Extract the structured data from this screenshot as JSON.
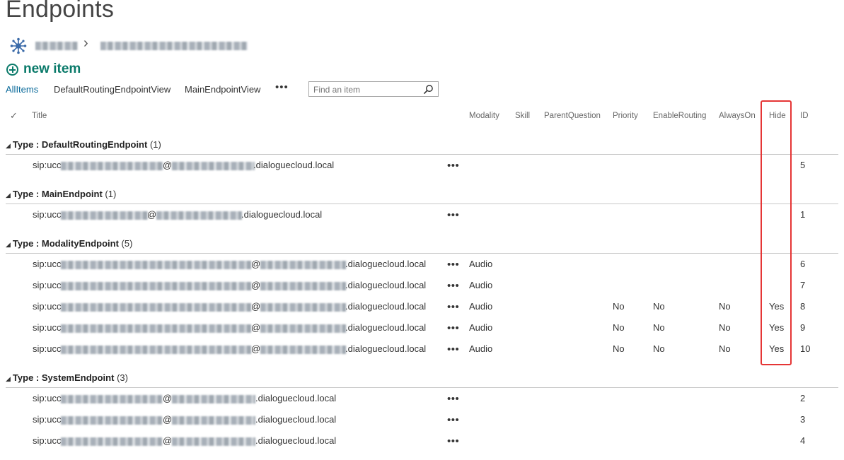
{
  "page": {
    "title": "Endpoints"
  },
  "new_item": {
    "label": "new item"
  },
  "views": [
    "AllItems",
    "DefaultRoutingEndpointView",
    "MainEndpointView"
  ],
  "more_views": "•••",
  "search": {
    "placeholder": "Find an item"
  },
  "columns": {
    "check": "✓",
    "title": "Title",
    "modality": "Modality",
    "skill": "Skill",
    "parent_question": "ParentQuestion",
    "priority": "Priority",
    "enable_routing": "EnableRouting",
    "always_on": "AlwaysOn",
    "hide": "Hide",
    "id": "ID"
  },
  "groups": [
    {
      "label": "Type : ",
      "name": "DefaultRoutingEndpoint",
      "count": "(1)",
      "rows": [
        {
          "prefix": "sip:ucc",
          "domain": ".dialoguecloud.local",
          "modality": "",
          "priority": "",
          "enable_routing": "",
          "always_on": "",
          "hide": "",
          "id": "5"
        }
      ]
    },
    {
      "label": "Type : ",
      "name": "MainEndpoint",
      "count": "(1)",
      "rows": [
        {
          "prefix": "sip:ucc",
          "domain": ".dialoguecloud.local",
          "modality": "",
          "priority": "",
          "enable_routing": "",
          "always_on": "",
          "hide": "",
          "id": "1"
        }
      ]
    },
    {
      "label": "Type : ",
      "name": "ModalityEndpoint",
      "count": "(5)",
      "rows": [
        {
          "prefix": "sip:ucc",
          "domain": ".dialoguecloud.local",
          "modality": "Audio",
          "priority": "",
          "enable_routing": "",
          "always_on": "",
          "hide": "",
          "id": "6"
        },
        {
          "prefix": "sip:ucc",
          "domain": ".dialoguecloud.local",
          "modality": "Audio",
          "priority": "",
          "enable_routing": "",
          "always_on": "",
          "hide": "",
          "id": "7"
        },
        {
          "prefix": "sip:ucc",
          "domain": ".dialoguecloud.local",
          "modality": "Audio",
          "priority": "No",
          "enable_routing": "No",
          "always_on": "No",
          "hide": "Yes",
          "id": "8"
        },
        {
          "prefix": "sip:ucc",
          "domain": ".dialoguecloud.local",
          "modality": "Audio",
          "priority": "No",
          "enable_routing": "No",
          "always_on": "No",
          "hide": "Yes",
          "id": "9"
        },
        {
          "prefix": "sip:ucc",
          "domain": ".dialoguecloud.local",
          "modality": "Audio",
          "priority": "No",
          "enable_routing": "No",
          "always_on": "No",
          "hide": "Yes",
          "id": "10"
        }
      ]
    },
    {
      "label": "Type : ",
      "name": "SystemEndpoint",
      "count": "(3)",
      "rows": [
        {
          "prefix": "sip:ucc",
          "domain": ".dialoguecloud.local",
          "modality": "",
          "priority": "",
          "enable_routing": "",
          "always_on": "",
          "hide": "",
          "id": "2"
        },
        {
          "prefix": "sip:ucc",
          "domain": ".dialoguecloud.local",
          "modality": "",
          "priority": "",
          "enable_routing": "",
          "always_on": "",
          "hide": "",
          "id": "3"
        },
        {
          "prefix": "sip:ucc",
          "domain": ".dialoguecloud.local",
          "modality": "",
          "priority": "",
          "enable_routing": "",
          "always_on": "",
          "hide": "",
          "id": "4"
        }
      ]
    }
  ],
  "row_actions": "•••",
  "at_sign": "@",
  "colors": {
    "accent": "#0a7a6a",
    "highlight_box": "#e53535",
    "selected_view": "#0a6a9a"
  }
}
